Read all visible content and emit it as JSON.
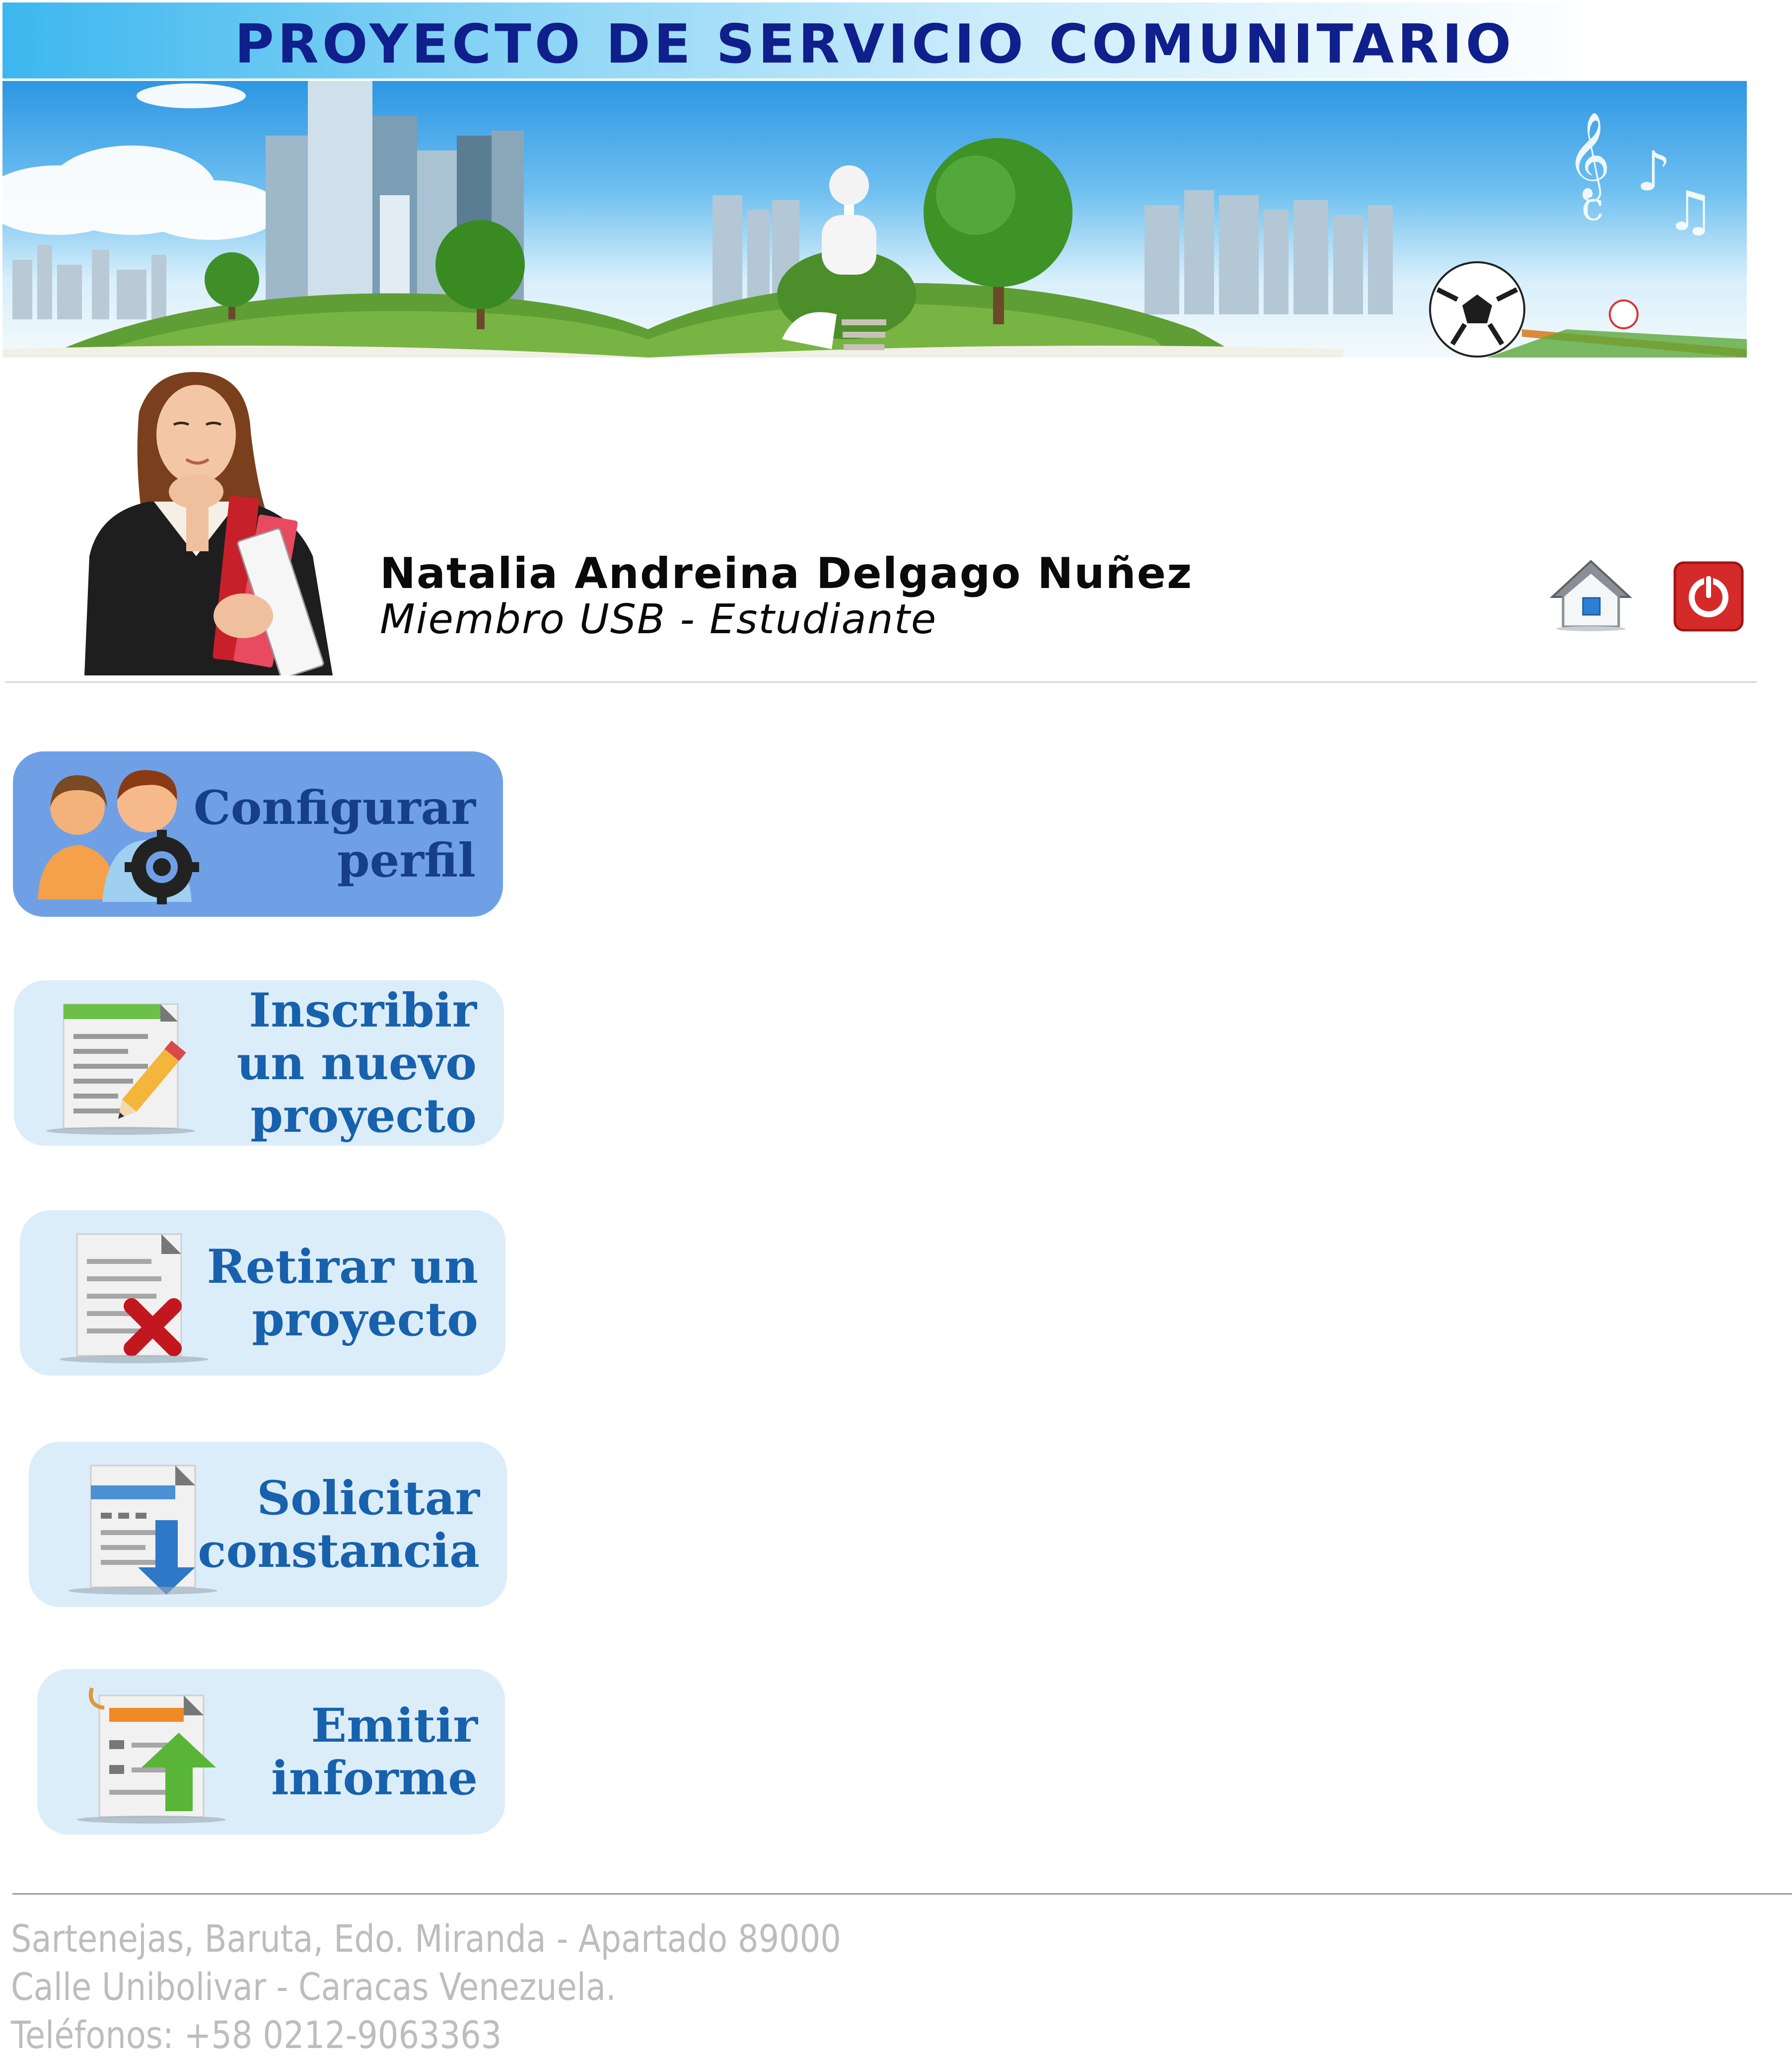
{
  "header": {
    "title": "PROYECTO DE SERVICIO COMUNITARIO"
  },
  "banner": {
    "description_icon": "city-banner-image"
  },
  "user": {
    "name": "Natalia Andreina Delgago Nuñez",
    "role": "Miembro USB - Estudiante",
    "avatar_icon": "student-avatar-image"
  },
  "actions": {
    "home_icon": "home-icon",
    "logout_icon": "power-icon"
  },
  "menu": [
    {
      "lines": [
        "Configurar",
        "perfil"
      ],
      "icon": "users-gear-icon",
      "active": true
    },
    {
      "lines": [
        "Inscribir",
        "un nuevo",
        "proyecto"
      ],
      "icon": "document-edit-icon",
      "active": false
    },
    {
      "lines": [
        "Retirar un",
        "proyecto"
      ],
      "icon": "document-delete-icon",
      "active": false
    },
    {
      "lines": [
        "Solicitar",
        "constancia"
      ],
      "icon": "document-download-icon",
      "active": false
    },
    {
      "lines": [
        "Emitir",
        "informe"
      ],
      "icon": "document-upload-icon",
      "active": false
    }
  ],
  "footer": {
    "address_line1": "Sartenejas, Baruta, Edo. Miranda - Apartado 89000",
    "address_line2": "Calle Unibolivar - Caracas Venezuela.",
    "phones": "Teléfonos: +58 0212-9063363"
  },
  "colors": {
    "title": "#0f1f8c",
    "menu_bg": "#dcedfa",
    "menu_active_bg": "#6fa0e6",
    "menu_text": "#1761ad",
    "footer_text": "#bdbdbd"
  }
}
